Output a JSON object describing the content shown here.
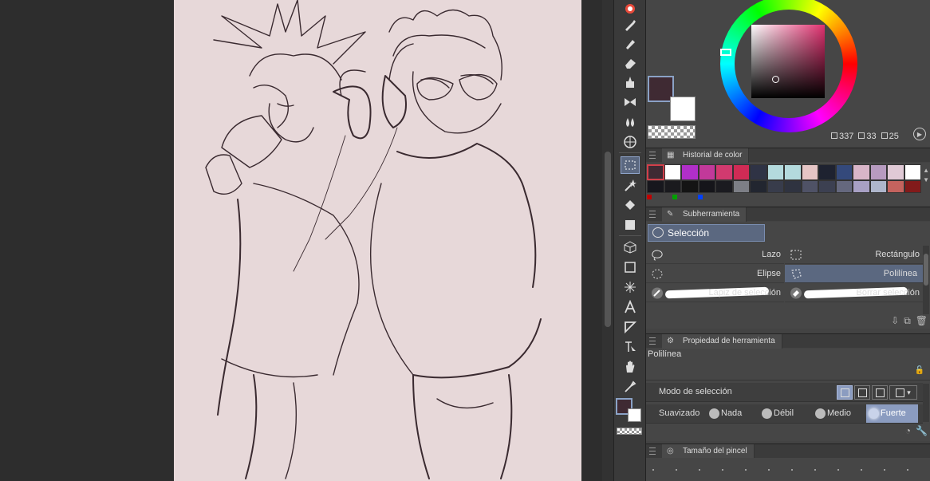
{
  "color_panel": {
    "readout": {
      "h": "337",
      "s": "33",
      "v": "25"
    },
    "main_color": "#3f2a33",
    "sub_color": "#ffffff"
  },
  "color_history": {
    "title": "Historial de color",
    "row1": [
      "#3f2a33",
      "#ffffff",
      "#b12fc9",
      "#c2399a",
      "#d23a6f",
      "#d02b55",
      "#2f3345",
      "#b4dadd",
      "#b4dadd",
      "#e5c5c5",
      "#1e2230",
      "#34497b",
      "#d8b5c8",
      "#b79bc0",
      "#e0cad6",
      "#ffffff"
    ],
    "row2": [
      "#17171d",
      "#1a1a1e",
      "#141414",
      "#15151a",
      "#1b1b20",
      "#7d7f86",
      "#222630",
      "#383c4b",
      "#2f3340",
      "#4f5266",
      "#3c4051",
      "#65687e",
      "#a8a0c4",
      "#aeb6cb",
      "#c4635e",
      "#821a1a"
    ],
    "dots": [
      "#c00000",
      "#00a000",
      "#0040ff"
    ]
  },
  "subtool": {
    "title": "Subherramienta",
    "group": "Selección",
    "items": [
      {
        "label": "Lazo",
        "selected": false
      },
      {
        "label": "Rectángulo",
        "selected": false
      },
      {
        "label": "Elipse",
        "selected": false
      },
      {
        "label": "Polilínea",
        "selected": true
      },
      {
        "label": "Lápiz de selección",
        "selected": false
      },
      {
        "label": "Borrar selección",
        "selected": false
      }
    ]
  },
  "tool_property": {
    "title": "Propiedad de herramienta",
    "tool_name": "Polilínea",
    "mode_label": "Modo de selección",
    "smoothing_label": "Suavizado",
    "smoothing_options": [
      "Nada",
      "Débil",
      "Medio",
      "Fuerte"
    ],
    "smoothing_selected": "Fuerte"
  },
  "brush_size": {
    "title": "Tamaño del pincel"
  },
  "icons": {
    "toolbar": [
      "pen-icon",
      "brush-icon",
      "eraser-icon",
      "ink-fill-icon",
      "decoration-icon",
      "blend-icon",
      "grid-icon",
      "selection-icon",
      "wand-icon",
      "fill-bucket-icon",
      "gradient-icon",
      "3d-icon",
      "shape-icon",
      "frame-icon",
      "text-icon",
      "ruler-icon",
      "operation-icon",
      "hand-icon",
      "eyedropper-icon"
    ]
  }
}
